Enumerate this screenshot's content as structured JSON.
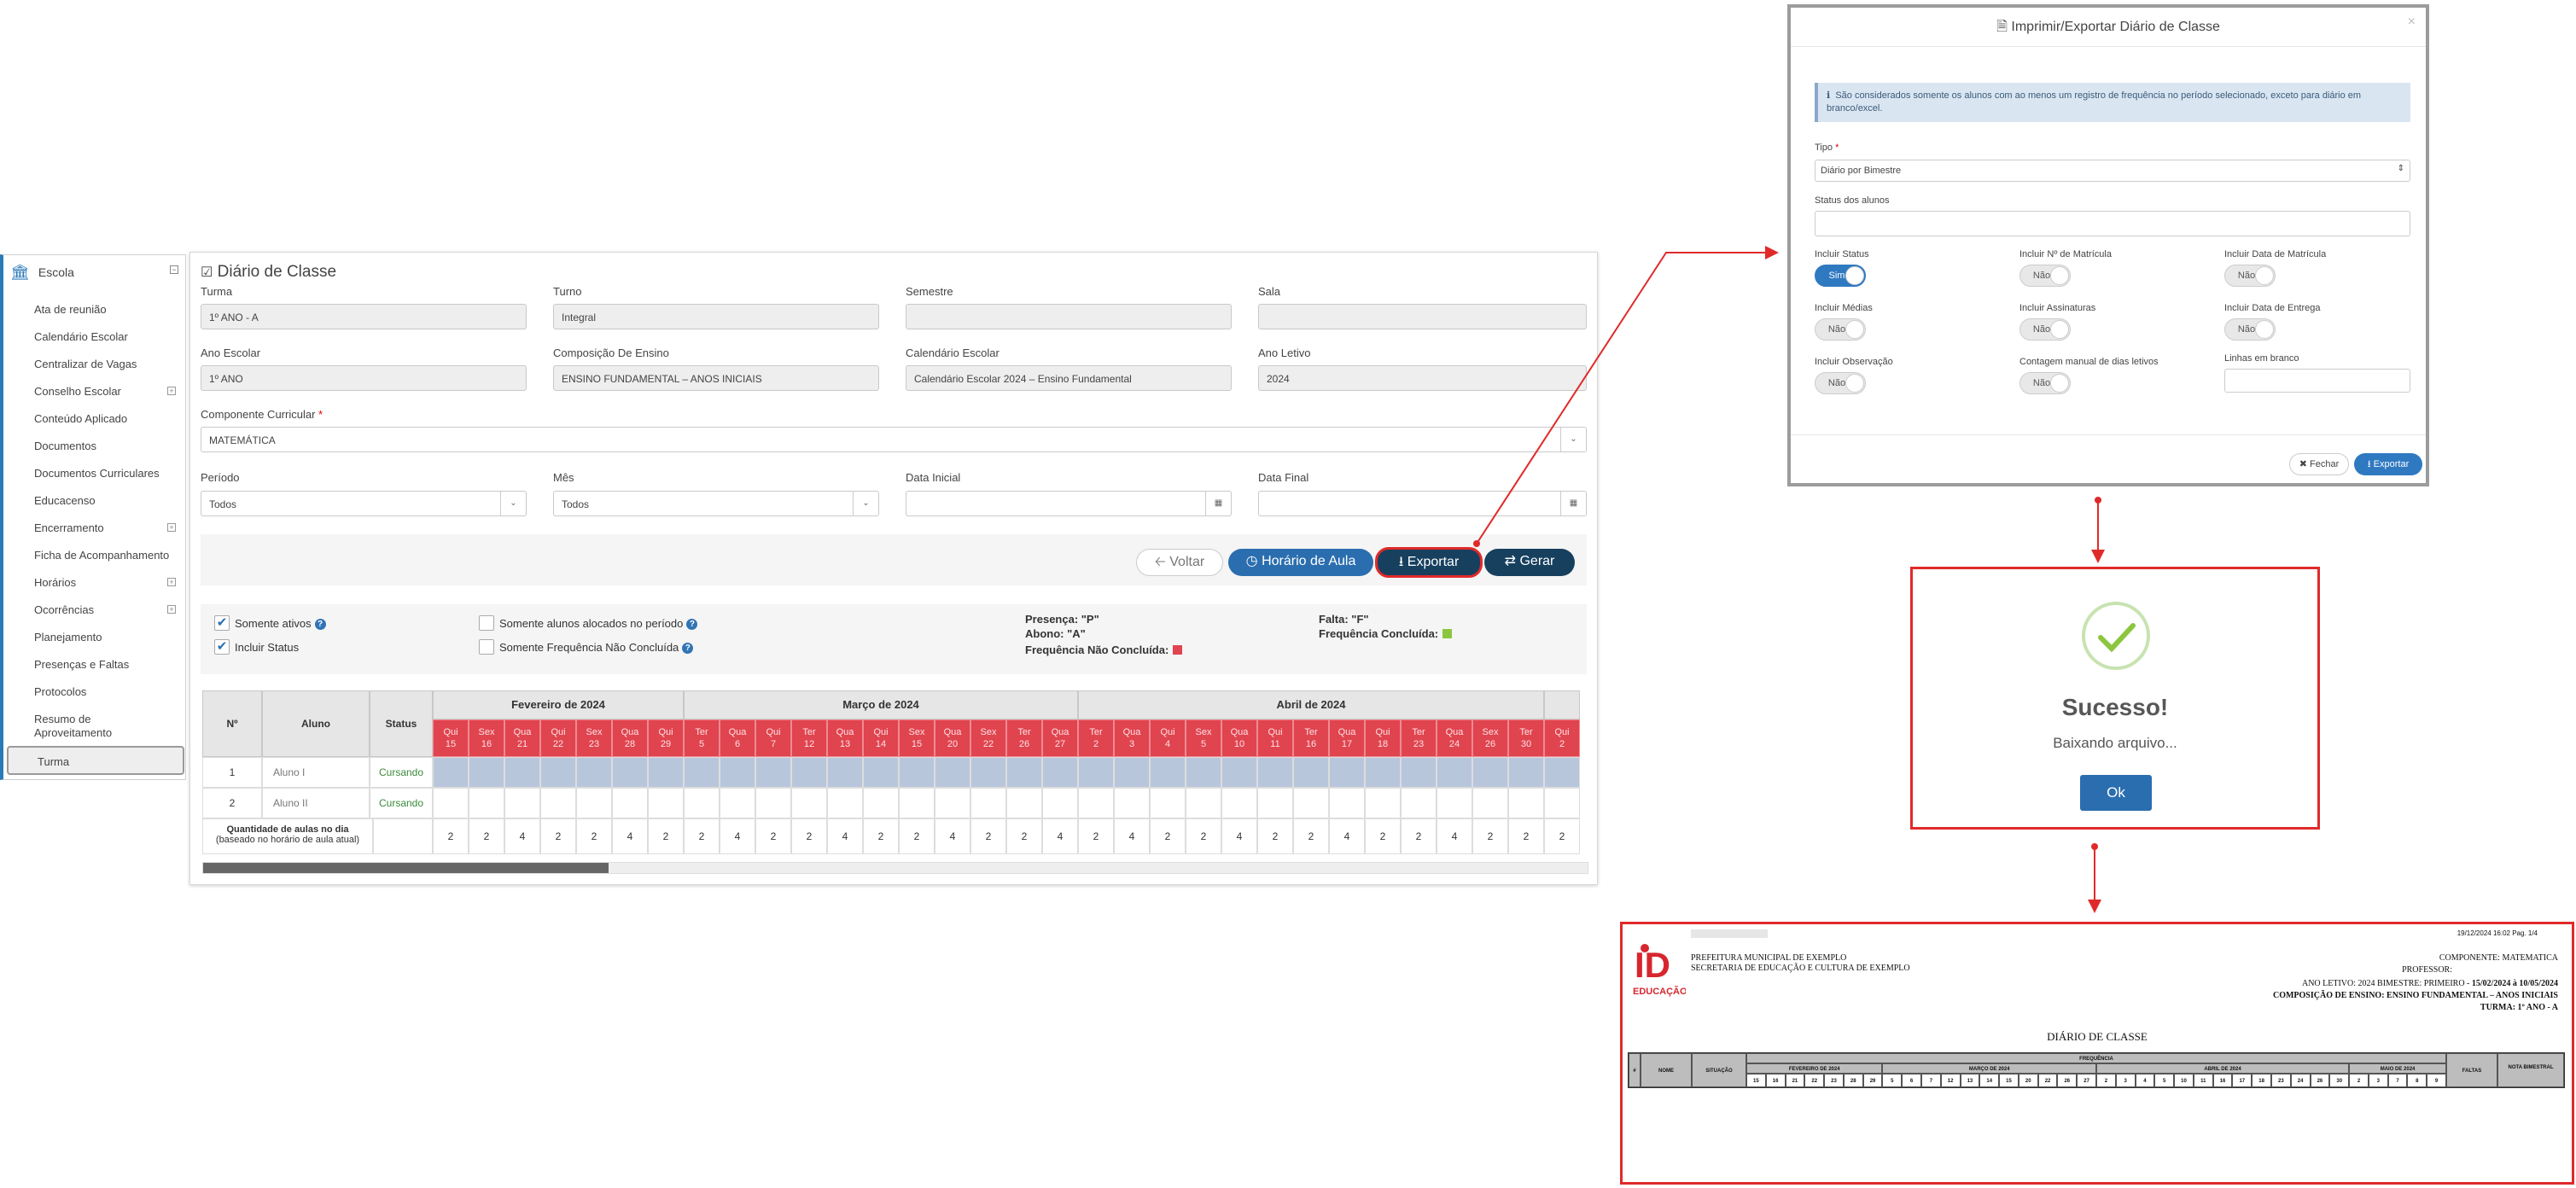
{
  "sidebar": {
    "title": "Escola",
    "items": [
      "Ata de reunião",
      "Calendário Escolar",
      "Centralizar de Vagas",
      "Conselho Escolar",
      "Conteúdo Aplicado",
      "Documentos",
      "Documentos Curriculares",
      "Educacenso",
      "Encerramento",
      "Ficha de Acompanhamento",
      "Horários",
      "Ocorrências",
      "Planejamento",
      "Presenças e Faltas",
      "Protocolos",
      "Resumo de",
      "Aproveitamento"
    ],
    "active": "Turma"
  },
  "main": {
    "title": "Diário de Classe",
    "fields": {
      "turma": {
        "label": "Turma",
        "value": "1º ANO - A"
      },
      "turno": {
        "label": "Turno",
        "value": "Integral"
      },
      "semestre": {
        "label": "Semestre",
        "value": ""
      },
      "sala": {
        "label": "Sala",
        "value": ""
      },
      "ano_escolar": {
        "label": "Ano Escolar",
        "value": "1º ANO"
      },
      "composicao": {
        "label": "Composição De Ensino",
        "value": "ENSINO FUNDAMENTAL – ANOS INICIAIS"
      },
      "calendario": {
        "label": "Calendário Escolar",
        "value": "Calendário Escolar 2024 – Ensino Fundamental"
      },
      "ano_letivo": {
        "label": "Ano Letivo",
        "value": "2024"
      },
      "componente": {
        "label": "Componente Curricular",
        "value": "MATEMÁTICA",
        "required": "*"
      },
      "periodo": {
        "label": "Período",
        "value": "Todos"
      },
      "mes": {
        "label": "Mês",
        "value": "Todos"
      },
      "data_inicial": {
        "label": "Data Inicial",
        "value": ""
      },
      "data_final": {
        "label": "Data Final",
        "value": ""
      }
    },
    "buttons": {
      "voltar": "Voltar",
      "horario": "Horário de Aula",
      "exportar": "Exportar",
      "gerar": "Gerar"
    },
    "checks": {
      "somente_ativos": "Somente ativos",
      "incluir_status": "Incluir Status",
      "somente_alocados": "Somente alunos alocados no período",
      "somente_freq": "Somente Frequência Não Concluída"
    },
    "legend": {
      "presenca": "Presença: \"P\"",
      "abono": "Abono: \"A\"",
      "freq_nao": "Frequência Não Concluída:",
      "falta": "Falta: \"F\"",
      "freq_conc": "Frequência Concluída:",
      "red": "#e0444f",
      "green": "#8cc63f"
    },
    "table": {
      "headers": {
        "n": "Nº",
        "aluno": "Aluno",
        "status": "Status"
      },
      "months": [
        "Fevereiro de 2024",
        "Março de 2024",
        "Abril de 2024"
      ],
      "days": [
        {
          "w": "Qui",
          "d": "15"
        },
        {
          "w": "Sex",
          "d": "16"
        },
        {
          "w": "Qua",
          "d": "21"
        },
        {
          "w": "Qui",
          "d": "22"
        },
        {
          "w": "Sex",
          "d": "23"
        },
        {
          "w": "Qua",
          "d": "28"
        },
        {
          "w": "Qui",
          "d": "29"
        },
        {
          "w": "Ter",
          "d": "5"
        },
        {
          "w": "Qua",
          "d": "6"
        },
        {
          "w": "Qui",
          "d": "7"
        },
        {
          "w": "Ter",
          "d": "12"
        },
        {
          "w": "Qua",
          "d": "13"
        },
        {
          "w": "Qui",
          "d": "14"
        },
        {
          "w": "Sex",
          "d": "15"
        },
        {
          "w": "Qua",
          "d": "20"
        },
        {
          "w": "Sex",
          "d": "22"
        },
        {
          "w": "Ter",
          "d": "26"
        },
        {
          "w": "Qua",
          "d": "27"
        },
        {
          "w": "Ter",
          "d": "2"
        },
        {
          "w": "Qua",
          "d": "3"
        },
        {
          "w": "Qui",
          "d": "4"
        },
        {
          "w": "Sex",
          "d": "5"
        },
        {
          "w": "Qua",
          "d": "10"
        },
        {
          "w": "Qui",
          "d": "11"
        },
        {
          "w": "Ter",
          "d": "16"
        },
        {
          "w": "Qua",
          "d": "17"
        },
        {
          "w": "Qui",
          "d": "18"
        },
        {
          "w": "Ter",
          "d": "23"
        },
        {
          "w": "Qua",
          "d": "24"
        },
        {
          "w": "Sex",
          "d": "26"
        },
        {
          "w": "Ter",
          "d": "30"
        },
        {
          "w": "Qui",
          "d": "2"
        }
      ],
      "month_spans": [
        7,
        11,
        13,
        1
      ],
      "rows": [
        {
          "n": "1",
          "aluno": "Aluno I",
          "status": "Cursando"
        },
        {
          "n": "2",
          "aluno": "Aluno II",
          "status": "Cursando"
        }
      ],
      "qtd_label": "Quantidade de aulas no dia",
      "qtd_sub": "(baseado no horário de aula atual)",
      "qtd": [
        "2",
        "2",
        "4",
        "2",
        "2",
        "4",
        "2",
        "2",
        "4",
        "2",
        "2",
        "4",
        "2",
        "2",
        "4",
        "2",
        "2",
        "4",
        "2",
        "4",
        "2",
        "2",
        "4",
        "2",
        "2",
        "4",
        "2",
        "2",
        "4",
        "2",
        "2",
        "2"
      ]
    }
  },
  "modal": {
    "title": "Imprimir/Exportar Diário de Classe",
    "close": "×",
    "info": "São considerados somente os alunos com ao menos um registro de frequência no período selecionado, exceto para diário em branco/excel.",
    "tipo_label": "Tipo",
    "tipo_value": "Diário por Bimestre",
    "status_label": "Status dos alunos",
    "opts": [
      {
        "label": "Incluir Status",
        "value": "Sim",
        "on": true
      },
      {
        "label": "Incluir Nº de Matrícula",
        "value": "Não",
        "on": false
      },
      {
        "label": "Incluir Data de Matrícula",
        "value": "Não",
        "on": false
      },
      {
        "label": "Incluir Médias",
        "value": "Não",
        "on": false
      },
      {
        "label": "Incluir Assinaturas",
        "value": "Não",
        "on": false
      },
      {
        "label": "Incluir Data de Entrega",
        "value": "Não",
        "on": false
      },
      {
        "label": "Incluir Observação",
        "value": "Não",
        "on": false
      },
      {
        "label": "Contagem manual de dias letivos",
        "value": "Não",
        "on": false
      }
    ],
    "linhas_label": "Linhas em branco",
    "fechar": "Fechar",
    "exportar": "Exportar"
  },
  "success": {
    "title": "Sucesso!",
    "text": "Baixando arquivo...",
    "ok": "Ok"
  },
  "pdf": {
    "stamp": "19/12/2024 16:02  Pag. 1/4",
    "pref": "PREFEITURA MUNICIPAL DE EXEMPLO",
    "sec": "SECRETARIA DE EDUCAÇÃO E CULTURA DE EXEMPLO",
    "comp": "COMPONENTE: MATEMATICA",
    "prof": "PROFESSOR:",
    "ano": "ANO LETIVO: 2024    BIMESTRE: PRIMEIRO - ",
    "ano_b": "15/02/2024 à 10/05/2024",
    "comp_ens": "COMPOSIÇÃO DE ENSINO: ENSINO FUNDAMENTAL – ANOS INICIAIS",
    "turma": "TURMA: 1º ANO - A",
    "doc_title": "DIÁRIO DE CLASSE",
    "cols": {
      "n": "#",
      "nome": "NOME",
      "situacao": "SITUAÇÃO",
      "freq": "FREQUÊNCIA",
      "faltas": "FALTAS",
      "nota": "NOTA BIMESTRAL"
    },
    "months": [
      "FEVEREIRO DE 2024",
      "MARÇO DE 2024",
      "ABRIL DE 2024",
      "MAIO DE 2024"
    ],
    "days": [
      "15",
      "16",
      "21",
      "22",
      "23",
      "28",
      "29",
      "5",
      "6",
      "7",
      "12",
      "13",
      "14",
      "15",
      "20",
      "22",
      "26",
      "27",
      "2",
      "3",
      "4",
      "5",
      "10",
      "11",
      "16",
      "17",
      "18",
      "23",
      "24",
      "26",
      "30",
      "2",
      "3",
      "7",
      "8",
      "9"
    ]
  }
}
